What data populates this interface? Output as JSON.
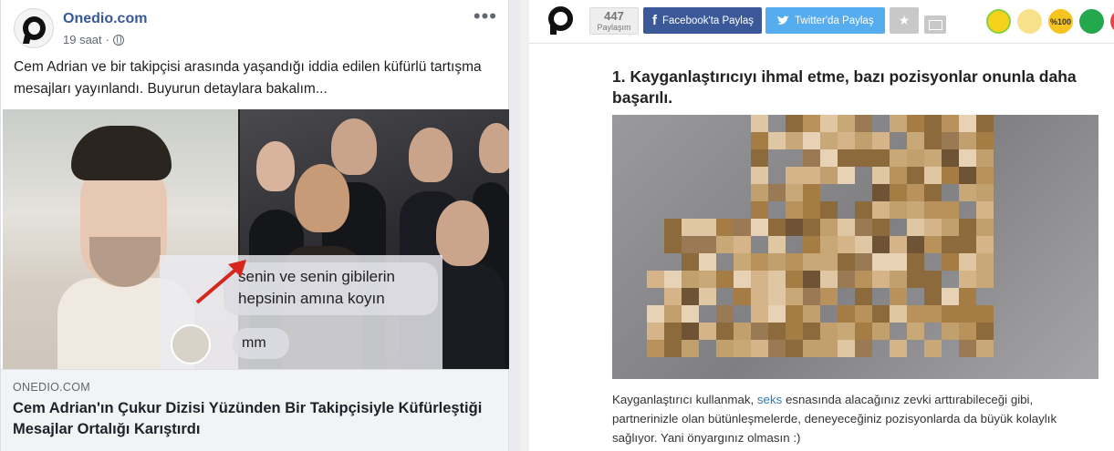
{
  "facebook_post": {
    "page_name": "Onedio.com",
    "time": "19 saat",
    "separator": "·",
    "post_text": "Cem Adrian ve bir takipçisi arasında yaşandığı iddia edilen küfürlü tartışma mesajları yayınlandı. Buyurun detaylara bakalım...",
    "more_label": "•••",
    "image_chat": {
      "line1": "senin ve senin gibilerin",
      "line2": "hepsinin amına koyın",
      "reply": "mm"
    },
    "link_domain": "ONEDIO.COM",
    "link_title": "Cem Adrian'ın Çukur Dizisi Yüzünden Bir Takipçisiyle Küfürleştiği Mesajlar Ortalığı Karıştırdı"
  },
  "onedio_article": {
    "share_count": "447",
    "share_label": "Paylaşım",
    "facebook_button": "Facebook'ta Paylaş",
    "twitter_button": "Twitter'da Paylaş",
    "reactions": [
      "",
      "",
      "%100",
      "",
      ""
    ],
    "heading": "1. Kayganlaştırıcıyı ihmal etme, bazı pozisyonlar onunla daha başarılı.",
    "paragraph_before_link": "Kayganlaştırıcı kullanmak, ",
    "paragraph_link": "seks",
    "paragraph_after_link": " esnasında alacağınız zevki arttırabileceği gibi, partnerinizle olan bütünleşmelerde, deneyeceğiniz pozisyonlarda da büyük kolaylık sağlıyor. Yani önyargınız olmasın :)",
    "icons": [
      "onedio-logo-icon",
      "facebook-icon",
      "twitter-icon",
      "star-icon",
      "mail-icon"
    ],
    "colors": {
      "facebook": "#3b5998",
      "twitter": "#55acee",
      "link": "#2a7abf"
    }
  }
}
